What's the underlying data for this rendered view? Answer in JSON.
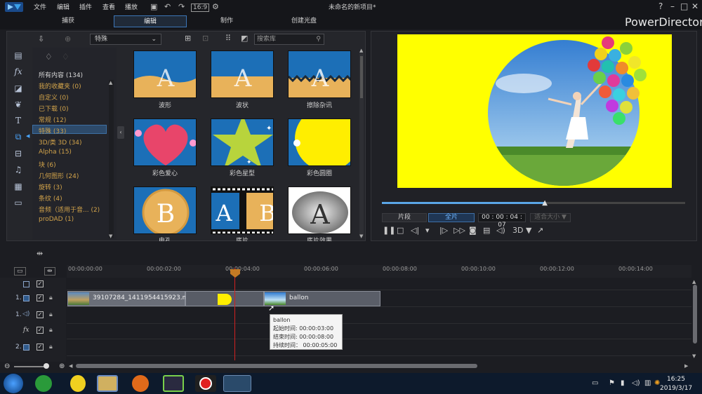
{
  "menu": [
    "文件",
    "编辑",
    "插件",
    "查看",
    "播放"
  ],
  "document_title": "未命名的新项目*",
  "window_buttons": {
    "help": "?",
    "minimize": "–",
    "maximize": "□",
    "close": "✕"
  },
  "modes": [
    "捕获",
    "编辑",
    "制作",
    "创建光盘"
  ],
  "brand": "PowerDirector",
  "library": {
    "category_select": "特殊",
    "search_placeholder": "搜索库",
    "categories": [
      "所有内容 (134)",
      "我的收藏夹 (0)",
      "自定义 (0)",
      "已下载 (0)",
      "常规 (12)",
      "特殊 (33)",
      "3D/类 3D (34)",
      "Alpha (15)",
      "块 (6)",
      "几何图形 (24)",
      "旋转 (3)",
      "条纹 (4)",
      "音频（适用于音... (2)",
      "proDAD (1)"
    ],
    "thumbs": [
      "波形",
      "波状",
      "擦除杂讯",
      "彩色爱心",
      "彩色星型",
      "彩色圆圈",
      "电孔",
      "底片",
      "底片效果"
    ]
  },
  "preview": {
    "clip_btn": "片段",
    "movie_btn": "全片",
    "timecode": "00 : 00 : 04 : 07",
    "fit_btn": "适合大小 ▼",
    "mode_3d": "3D ▼",
    "progress_fraction": 0.54
  },
  "timeline": {
    "ruler": [
      "00:00:00:00",
      "00:00:02:00",
      "00:00:04:00",
      "00:00:06:00",
      "00:00:08:00",
      "00:00:10:00",
      "00:00:12:00",
      "00:00:14:00"
    ],
    "tracks": [
      "1.",
      "1.",
      "fx",
      "2."
    ],
    "clip1_label": "39107284_1411954415923.mth",
    "clip2_label": "ballon",
    "tooltip": {
      "name": "ballon",
      "start": "起始时间: 00:00:03:00",
      "end": "结束时间: 00:00:08:00",
      "duration": "持续时间： 00:00:05:00"
    }
  },
  "taskbar": {
    "time": "16:25",
    "date": "2019/3/17"
  },
  "colors": {
    "accent": "#3c76b8",
    "preview_bg": "#ffff00",
    "playhead": "#d02020"
  }
}
